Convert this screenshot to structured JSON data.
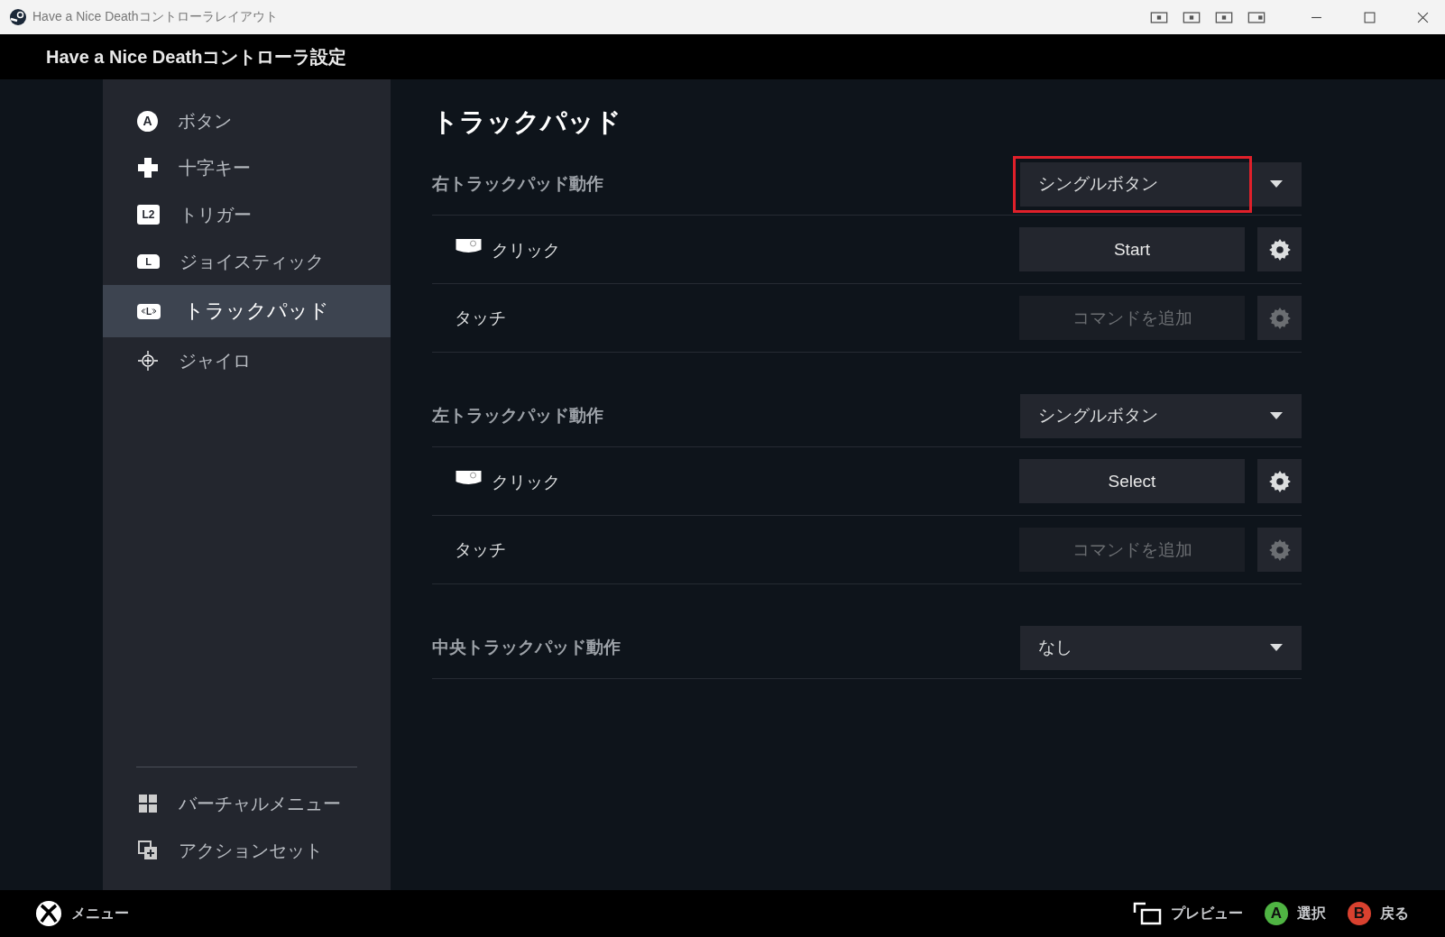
{
  "window": {
    "title": "Have a Nice Deathコントローラレイアウト"
  },
  "header": {
    "title": "Have a Nice Deathコントローラ設定"
  },
  "sidebar": {
    "items": [
      {
        "kind": "face-button",
        "badge": "A",
        "label": "ボタン",
        "selected": false
      },
      {
        "kind": "dpad",
        "label": "十字キー",
        "selected": false
      },
      {
        "kind": "trigger",
        "badge": "L2",
        "label": "トリガー",
        "selected": false
      },
      {
        "kind": "joystick",
        "badge": "L",
        "label": "ジョイスティック",
        "selected": false
      },
      {
        "kind": "trackpad",
        "badge": "L",
        "label": "トラックパッド",
        "selected": true
      },
      {
        "kind": "gyro",
        "label": "ジャイロ",
        "selected": false
      }
    ],
    "bottom_items": [
      {
        "kind": "grid",
        "label": "バーチャルメニュー"
      },
      {
        "kind": "actionset",
        "label": "アクションセット"
      }
    ]
  },
  "content": {
    "title": "トラックパッド",
    "sections": [
      {
        "label": "右トラックパッド動作",
        "dropdown": {
          "value": "シングルボタン",
          "highlighted": true
        },
        "rows": [
          {
            "kind": "click",
            "label": "クリック",
            "binding": "Start",
            "assigned": true
          },
          {
            "kind": "touch",
            "label": "タッチ",
            "binding": "コマンドを追加",
            "assigned": false
          }
        ]
      },
      {
        "label": "左トラックパッド動作",
        "dropdown": {
          "value": "シングルボタン",
          "highlighted": false
        },
        "rows": [
          {
            "kind": "click",
            "label": "クリック",
            "binding": "Select",
            "assigned": true
          },
          {
            "kind": "touch",
            "label": "タッチ",
            "binding": "コマンドを追加",
            "assigned": false
          }
        ]
      },
      {
        "label": "中央トラックパッド動作",
        "dropdown": {
          "value": "なし",
          "highlighted": false
        }
      }
    ]
  },
  "footer": {
    "menu": {
      "label": "メニュー"
    },
    "actions": [
      {
        "kind": "preview",
        "label": "プレビュー"
      },
      {
        "kind": "button",
        "badge": "A",
        "color": "#4fb443",
        "label": "選択"
      },
      {
        "kind": "button",
        "badge": "B",
        "color": "#d9412f",
        "label": "戻る"
      }
    ]
  }
}
